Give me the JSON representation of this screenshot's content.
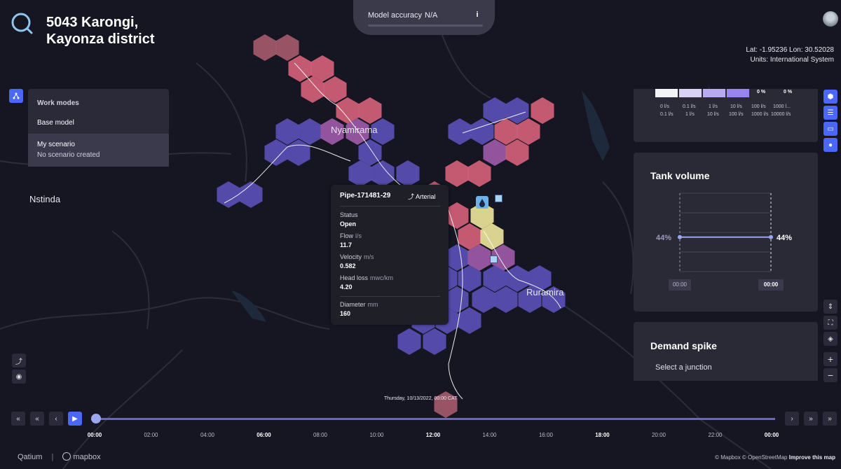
{
  "header": {
    "title_line1": "5043 Karongi,",
    "title_line2": "Kayonza district"
  },
  "model_accuracy": {
    "label": "Model accuracy",
    "value": "N/A",
    "info_icon": "info-icon"
  },
  "coords": {
    "line1": "Lat: -1.95236 Lon: 30.52028",
    "line2": "Units: International System"
  },
  "work_modes": {
    "heading": "Work modes",
    "base": "Base model",
    "scenario_title": "My scenario",
    "scenario_sub": "No scenario created"
  },
  "map_labels": {
    "nyamirama": "Nyamirama",
    "nstinda": "Nstinda",
    "ruramira": "Ruramira"
  },
  "pipe_tooltip": {
    "name": "Pipe-171481-29",
    "type": "Arterial",
    "status_label": "Status",
    "status_value": "Open",
    "flow_label": "Flow",
    "flow_unit": "l/s",
    "flow_value": "11.7",
    "velocity_label": "Velocity",
    "velocity_unit": "m/s",
    "velocity_value": "0.582",
    "headloss_label": "Head loss",
    "headloss_unit": "mwc/km",
    "headloss_value": "4.20",
    "diameter_label": "Diameter",
    "diameter_unit": "mm",
    "diameter_value": "160"
  },
  "legend": {
    "colors": [
      "#f4f4f6",
      "#d9d2f5",
      "#b9a8f2",
      "#9a84ee"
    ],
    "pct": [
      "0 %",
      "0 %"
    ],
    "row1": [
      "0 l/s",
      "0.1 l/s",
      "1 l/s",
      "10 l/s",
      "100 l/s",
      "1000 l..."
    ],
    "row2": [
      "0.1 l/s",
      "1 l/s",
      "10 l/s",
      "100 l/s",
      "1000 l/s",
      "10000 l/s"
    ]
  },
  "tank": {
    "title": "Tank volume",
    "left_value": "44%",
    "right_value": "44%",
    "start_time": "00:00",
    "end_time": "00:00",
    "level_pct": 44
  },
  "demand": {
    "title": "Demand spike",
    "prompt": "Select a junction"
  },
  "timeline": {
    "date": "Thursday, 10/13/2022, 00:00 CAT",
    "ticks": [
      "00:00",
      "02:00",
      "04:00",
      "06:00",
      "08:00",
      "10:00",
      "12:00",
      "14:00",
      "16:00",
      "18:00",
      "20:00",
      "22:00",
      "00:00"
    ],
    "bold_ticks": [
      0,
      3,
      6,
      9,
      12
    ],
    "progress": 0
  },
  "footer": {
    "brand": "Qatium",
    "partner": "mapbox",
    "attribution": "© Mapbox © OpenStreetMap",
    "improve": "Improve this map"
  },
  "colors": {
    "accent": "#4a68f5",
    "hex_purple": "#5a4fb6",
    "hex_pink": "#d4617a",
    "hex_yellow": "#ebe49a"
  }
}
